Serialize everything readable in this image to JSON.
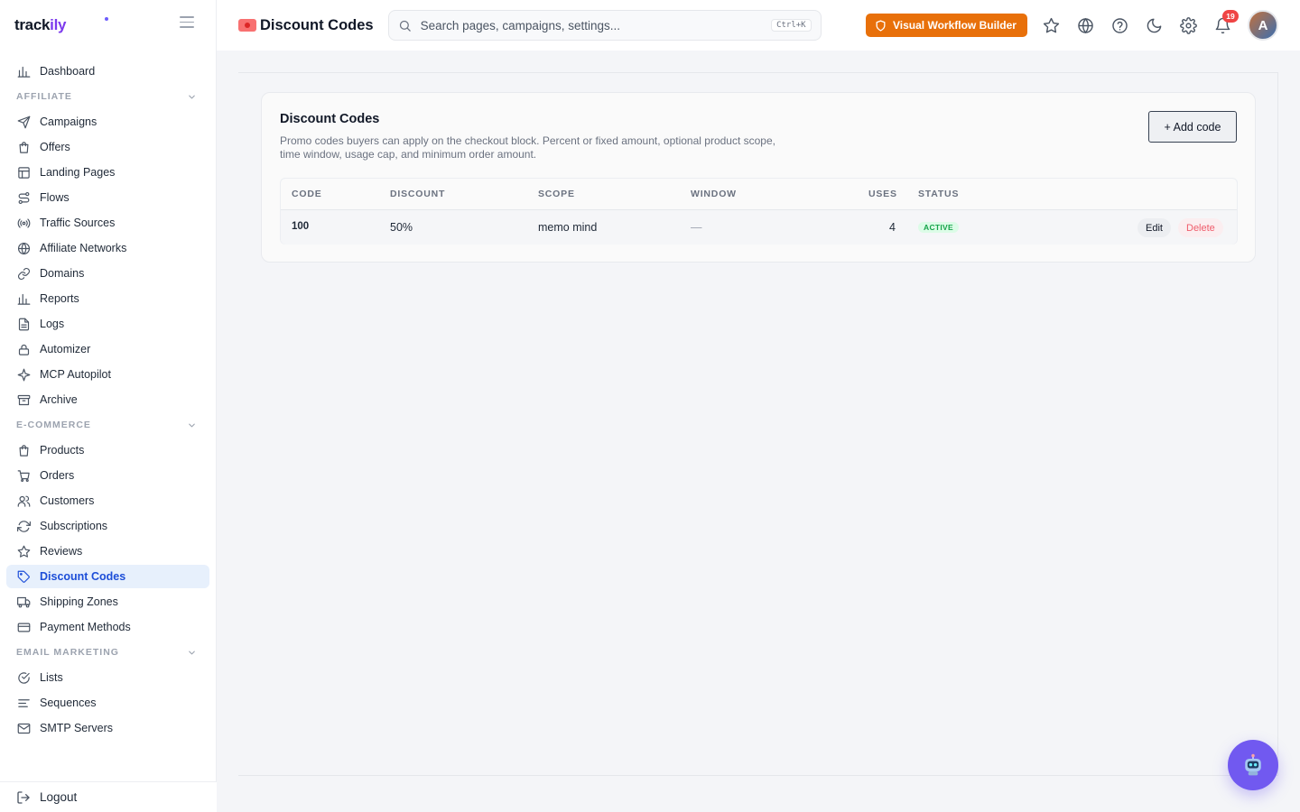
{
  "brand": {
    "name_main": "track",
    "name_accent": "ily"
  },
  "sidebar": {
    "top_items": [
      {
        "label": "Dashboard",
        "icon": "bar-chart-icon"
      }
    ],
    "sections": [
      {
        "title": "AFFILIATE",
        "items": [
          {
            "label": "Campaigns",
            "icon": "send-icon"
          },
          {
            "label": "Offers",
            "icon": "shopping-bag-icon"
          },
          {
            "label": "Landing Pages",
            "icon": "layout-icon"
          },
          {
            "label": "Flows",
            "icon": "route-icon"
          },
          {
            "label": "Traffic Sources",
            "icon": "radio-icon"
          },
          {
            "label": "Affiliate Networks",
            "icon": "globe-icon"
          },
          {
            "label": "Domains",
            "icon": "link-icon"
          },
          {
            "label": "Reports",
            "icon": "bar-chart-icon"
          },
          {
            "label": "Logs",
            "icon": "file-text-icon"
          },
          {
            "label": "Automizer",
            "icon": "lock-icon"
          },
          {
            "label": "MCP Autopilot",
            "icon": "sparkle-icon"
          },
          {
            "label": "Archive",
            "icon": "archive-icon"
          }
        ]
      },
      {
        "title": "E-COMMERCE",
        "items": [
          {
            "label": "Products",
            "icon": "shopping-bag-icon"
          },
          {
            "label": "Orders",
            "icon": "cart-icon"
          },
          {
            "label": "Customers",
            "icon": "users-icon"
          },
          {
            "label": "Subscriptions",
            "icon": "refresh-icon"
          },
          {
            "label": "Reviews",
            "icon": "star-icon"
          },
          {
            "label": "Discount Codes",
            "icon": "tag-icon",
            "active": true
          },
          {
            "label": "Shipping Zones",
            "icon": "truck-icon"
          },
          {
            "label": "Payment Methods",
            "icon": "credit-card-icon"
          }
        ]
      },
      {
        "title": "EMAIL MARKETING",
        "items": [
          {
            "label": "Lists",
            "icon": "check-circle-icon"
          },
          {
            "label": "Sequences",
            "icon": "align-left-icon"
          },
          {
            "label": "SMTP Servers",
            "icon": "mail-icon"
          }
        ]
      }
    ],
    "logout_label": "Logout"
  },
  "header": {
    "title": "Discount Codes",
    "search_placeholder": "Search pages, campaigns, settings...",
    "search_shortcut": "Ctrl+K",
    "workflow_button": "Visual Workflow Builder",
    "notification_count": "19",
    "avatar_initial": "A"
  },
  "card": {
    "title": "Discount Codes",
    "description": "Promo codes buyers can apply on the checkout block. Percent or fixed amount, optional product scope, time window, usage cap, and minimum order amount.",
    "add_button": "+ Add code",
    "columns": {
      "code": "CODE",
      "discount": "DISCOUNT",
      "scope": "SCOPE",
      "window": "WINDOW",
      "uses": "USES",
      "status": "STATUS"
    },
    "rows": [
      {
        "code": "100",
        "discount": "50%",
        "scope": "memo mind",
        "window": "—",
        "uses": "4",
        "status": "ACTIVE",
        "edit_label": "Edit",
        "delete_label": "Delete"
      }
    ]
  },
  "colors": {
    "accent": "#7c3aed",
    "workflow_button": "#e8700a",
    "active_nav_bg": "#e7f0fc",
    "active_nav_text": "#1d4ed8",
    "status_active": "#16a34a",
    "delete_text": "#ef5d6c",
    "fab": "#7159f0"
  }
}
